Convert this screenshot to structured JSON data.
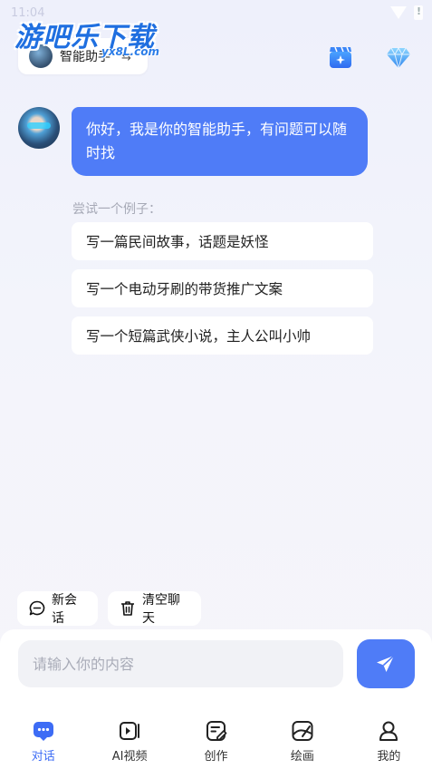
{
  "status_bar": {
    "time": "11:04"
  },
  "watermark": {
    "main": "游吧乐下载",
    "sub": "yx8L.com"
  },
  "header": {
    "assistant_name": "智能助手",
    "switch_icon": "swap-arrows-icon",
    "icons": [
      "clapper-icon",
      "diamond-icon"
    ]
  },
  "chat": {
    "greeting": "你好，我是你的智能助手，有问题可以随时找",
    "example_title": "尝试一个例子：",
    "examples": [
      "写一篇民间故事，话题是妖怪",
      "写一个电动牙刷的带货推广文案",
      "写一个短篇武侠小说，主人公叫小帅"
    ]
  },
  "actions": {
    "new_chat": "新会话",
    "clear_chat": "清空聊天"
  },
  "input": {
    "placeholder": "请输入你的内容",
    "value": ""
  },
  "tabs": [
    {
      "label": "对话",
      "icon": "chat-bubble-icon",
      "active": true
    },
    {
      "label": "AI视频",
      "icon": "video-play-icon",
      "active": false
    },
    {
      "label": "创作",
      "icon": "edit-document-icon",
      "active": false
    },
    {
      "label": "绘画",
      "icon": "painting-icon",
      "active": false
    },
    {
      "label": "我的",
      "icon": "user-profile-icon",
      "active": false
    }
  ],
  "colors": {
    "accent": "#4f7cf7",
    "tab_active": "#3d6cf5"
  }
}
